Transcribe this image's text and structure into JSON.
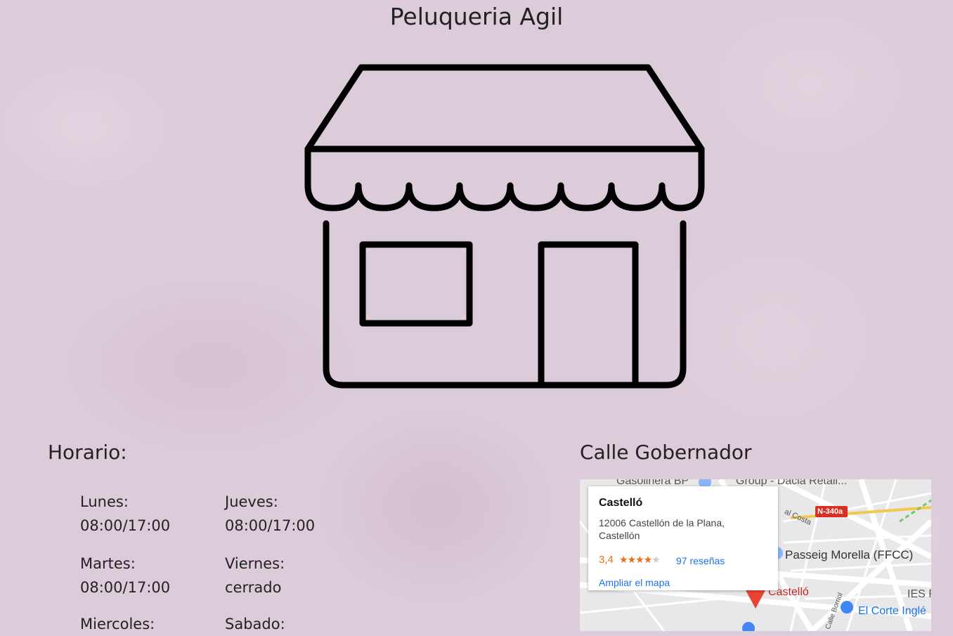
{
  "header": {
    "title": "Peluqueria Agil"
  },
  "icons": {
    "shop": "storefront-icon",
    "pin": "map-pin-icon"
  },
  "horario": {
    "title": "Horario:",
    "days": [
      {
        "day": "Lunes:",
        "hours": "08:00/17:00"
      },
      {
        "day": "Martes:",
        "hours": "08:00/17:00"
      },
      {
        "day": "Miercoles:",
        "hours": ""
      },
      {
        "day": "Jueves:",
        "hours": "08:00/17:00"
      },
      {
        "day": "Viernes:",
        "hours": "cerrado"
      },
      {
        "day": "Sabado:",
        "hours": ""
      }
    ]
  },
  "address": {
    "title": "Calle Gobernador"
  },
  "map": {
    "place_name": "Castelló",
    "address": "12006 Castellón de la Plana, Castellón",
    "rating": "3,4",
    "stars": 3.4,
    "reviews": "97 reseñas",
    "enlarge_link": "Ampliar el mapa",
    "labels": {
      "gas_station": "Gasolinera BP",
      "group": "Group - Dacia Retail...",
      "road": "N-340a",
      "station": "Passeig Morella (FFCC)",
      "pin_label": "Castelló",
      "school": "IES Fra",
      "store": "El Corte Inglé",
      "street1": "al Costa",
      "street2": "Calle Borriol"
    }
  },
  "colors": {
    "background": "#dccbd9",
    "link": "#1a73e8",
    "rating": "#e7711b",
    "pin": "#ea4335"
  }
}
